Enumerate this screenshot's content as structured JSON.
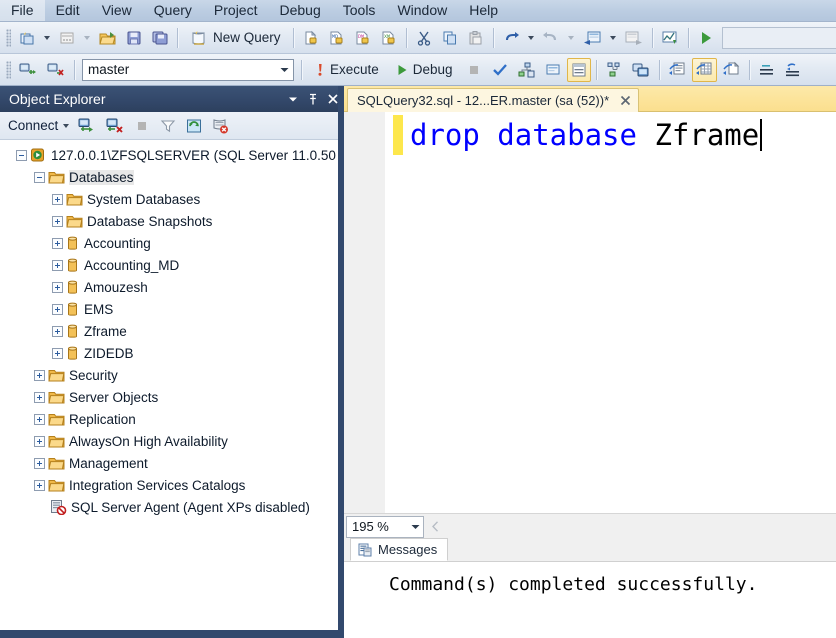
{
  "menu": {
    "items": [
      {
        "label": "File"
      },
      {
        "label": "Edit"
      },
      {
        "label": "View"
      },
      {
        "label": "Query"
      },
      {
        "label": "Project"
      },
      {
        "label": "Debug"
      },
      {
        "label": "Tools"
      },
      {
        "label": "Window"
      },
      {
        "label": "Help"
      }
    ]
  },
  "toolbar_standard": {
    "new_query_label": "New Query",
    "icons": [
      "new-project-icon",
      "new-item-icon",
      "open-file-icon",
      "save-icon",
      "save-all-icon",
      "new-query-icon",
      "new-analysis-query-icon",
      "new-mdx-query-icon",
      "new-dmx-query-icon",
      "new-xmla-query-icon",
      "cut-icon",
      "copy-icon",
      "paste-icon",
      "undo-icon",
      "redo-icon",
      "navigate-backward-icon",
      "navigate-forward-icon",
      "activity-monitor-icon",
      "start-debug-icon"
    ]
  },
  "toolbar_editor": {
    "database_value": "master",
    "database_placeholder": "master",
    "execute_label": "Execute",
    "debug_label": "Debug",
    "icons": [
      "connect-icon",
      "disconnect-icon",
      "execute-icon",
      "debug-icon",
      "stop-icon",
      "parse-icon",
      "display-estimated-plan-icon",
      "query-options-icon",
      "include-actual-plan-icon",
      "include-client-stats-icon",
      "results-to-text-icon",
      "results-to-grid-icon",
      "results-to-file-icon",
      "comment-icon",
      "uncomment-icon",
      "decrease-indent-icon",
      "increase-indent-icon"
    ]
  },
  "object_explorer": {
    "title": "Object Explorer",
    "connect_label": "Connect",
    "toolbar_icons": [
      "connect-object-explorer-icon",
      "disconnect-object-explorer-icon",
      "stop-icon",
      "filter-icon",
      "refresh-icon",
      "cancel-refresh-icon"
    ],
    "window_buttons": [
      "window-dropdown-icon",
      "auto-hide-pin-icon",
      "close-icon"
    ],
    "tree": [
      {
        "label": "127.0.0.1\\ZFSQLSERVER (SQL Server 11.0.50",
        "depth": 0,
        "icon": "server-icon",
        "expander": "minus",
        "selected": false
      },
      {
        "label": "Databases",
        "depth": 1,
        "icon": "folder-icon",
        "expander": "minus",
        "selected": true
      },
      {
        "label": "System Databases",
        "depth": 2,
        "icon": "folder-icon",
        "expander": "plus",
        "selected": false
      },
      {
        "label": "Database Snapshots",
        "depth": 2,
        "icon": "folder-icon",
        "expander": "plus",
        "selected": false
      },
      {
        "label": "Accounting",
        "depth": 2,
        "icon": "database-icon",
        "expander": "plus",
        "selected": false
      },
      {
        "label": "Accounting_MD",
        "depth": 2,
        "icon": "database-icon",
        "expander": "plus",
        "selected": false
      },
      {
        "label": "Amouzesh",
        "depth": 2,
        "icon": "database-icon",
        "expander": "plus",
        "selected": false
      },
      {
        "label": "EMS",
        "depth": 2,
        "icon": "database-icon",
        "expander": "plus",
        "selected": false
      },
      {
        "label": "Zframe",
        "depth": 2,
        "icon": "database-icon",
        "expander": "plus",
        "selected": false
      },
      {
        "label": "ZIDEDB",
        "depth": 2,
        "icon": "database-icon",
        "expander": "plus",
        "selected": false
      },
      {
        "label": "Security",
        "depth": 1,
        "icon": "folder-icon",
        "expander": "plus",
        "selected": false
      },
      {
        "label": "Server Objects",
        "depth": 1,
        "icon": "folder-icon",
        "expander": "plus",
        "selected": false
      },
      {
        "label": "Replication",
        "depth": 1,
        "icon": "folder-icon",
        "expander": "plus",
        "selected": false
      },
      {
        "label": "AlwaysOn High Availability",
        "depth": 1,
        "icon": "folder-icon",
        "expander": "plus",
        "selected": false
      },
      {
        "label": "Management",
        "depth": 1,
        "icon": "folder-icon",
        "expander": "plus",
        "selected": false
      },
      {
        "label": "Integration Services Catalogs",
        "depth": 1,
        "icon": "folder-icon",
        "expander": "plus",
        "selected": false
      },
      {
        "label": "SQL Server Agent (Agent XPs disabled)",
        "depth": 1,
        "icon": "sql-agent-disabled-icon",
        "expander": "none",
        "selected": false
      }
    ]
  },
  "editor": {
    "tab_title": "SQLQuery32.sql - 12...ER.master (sa (52))*",
    "code": {
      "keyword": "drop database ",
      "identifier": "Zframe"
    },
    "zoom_level": "195 %"
  },
  "results": {
    "tab_label": "Messages",
    "tab_icon": "messages-icon",
    "message": "Command(s) completed successfully."
  },
  "colors": {
    "menubar": "#bccde2",
    "oe_title_bg": "#33486a",
    "oe_border": "#32496d",
    "tab_active": "#fdf6e0",
    "tabstrip": "#fbdf8e",
    "keyword_blue": "#0000ff",
    "change_bar_yellow": "#fde74c",
    "text_dark": "#1b2838"
  }
}
